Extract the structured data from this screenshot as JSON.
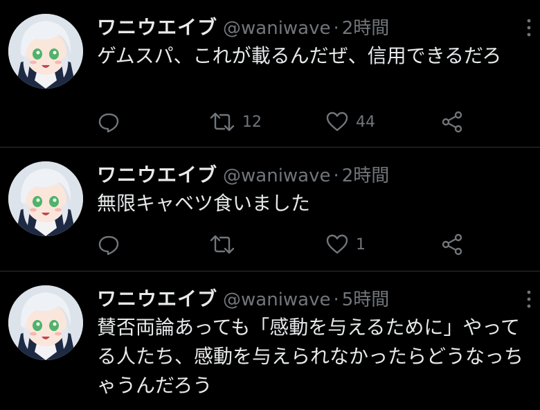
{
  "tweets": [
    {
      "name": "ワニウエイブ",
      "handle": "@waniwave",
      "separator": "·",
      "time": "2時間",
      "text": "ゲムスパ、これが載るんだぜ、信用できるだろ",
      "reply_count": "",
      "retweet_count": "12",
      "like_count": "44"
    },
    {
      "name": "ワニウエイブ",
      "handle": "@waniwave",
      "separator": "·",
      "time": "2時間",
      "text": "無限キャベツ食いました",
      "reply_count": "",
      "retweet_count": "",
      "like_count": "1"
    },
    {
      "name": "ワニウエイブ",
      "handle": "@waniwave",
      "separator": "·",
      "time": "5時間",
      "text": "賛否両論あっても「感動を与えるために」やってる人たち、感動を与えられなかったらどうなっちゃうんだろう"
    }
  ],
  "icons": {
    "reply": "reply-icon",
    "retweet": "retweet-icon",
    "like": "heart-icon",
    "share": "share-icon",
    "more": "more-icon"
  },
  "colors": {
    "background": "#000000",
    "text": "#e7e9ea",
    "muted": "#71767b",
    "divider": "#2f3336"
  }
}
